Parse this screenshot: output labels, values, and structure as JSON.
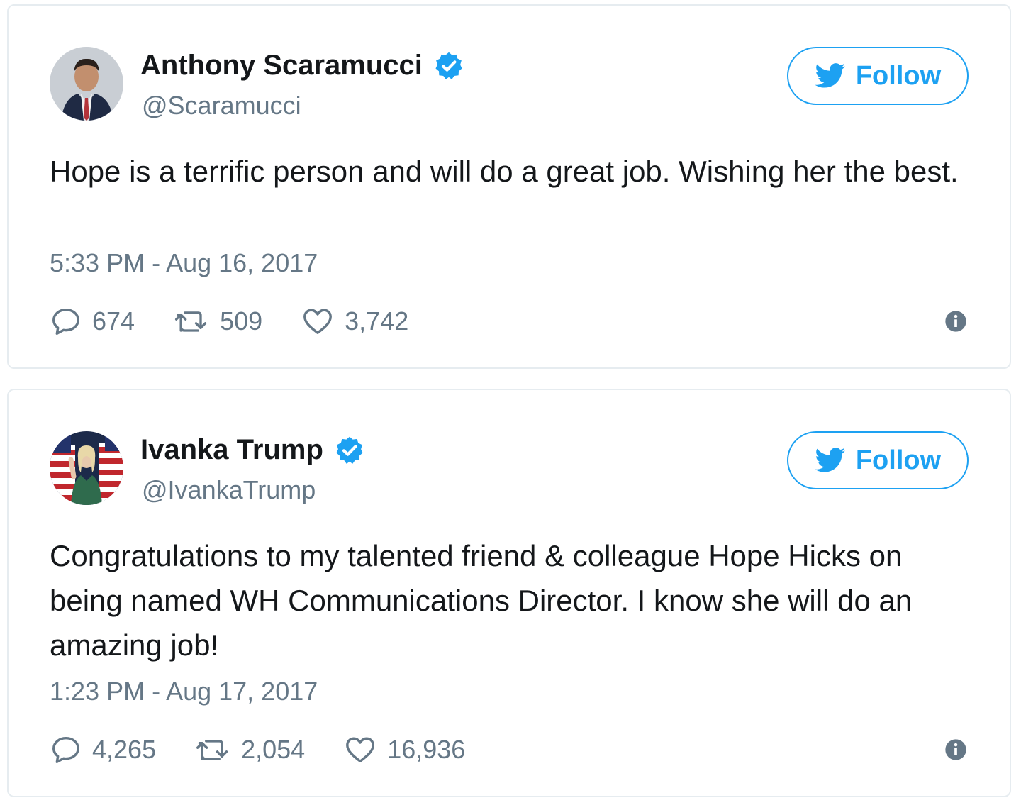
{
  "tweets": [
    {
      "display_name": "Anthony Scaramucci",
      "handle": "@Scaramucci",
      "follow_label": "Follow",
      "text": "Hope is a terrific person and will do a great job. Wishing her the best.",
      "timestamp": "5:33 PM - Aug 16, 2017",
      "replies": "674",
      "retweets": "509",
      "likes": "3,742",
      "verified": true,
      "avatar_icon": "man-in-suit-avatar"
    },
    {
      "display_name": "Ivanka Trump",
      "handle": "@IvankaTrump",
      "follow_label": "Follow",
      "text": "Congratulations to my talented friend & colleague Hope Hicks on being named WH Communications Director. I know she will do an amazing job!",
      "timestamp": "1:23 PM - Aug 17, 2017",
      "replies": "4,265",
      "retweets": "2,054",
      "likes": "16,936",
      "verified": true,
      "avatar_icon": "woman-with-flags-avatar"
    }
  ],
  "colors": {
    "brand_blue": "#1da1f2",
    "muted_text": "#657786",
    "border": "#e6ecf0",
    "text": "#14171a"
  }
}
